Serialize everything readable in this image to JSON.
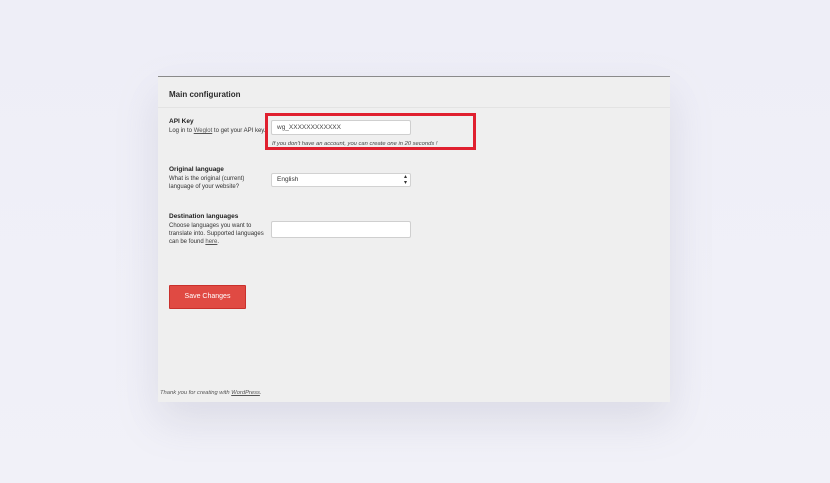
{
  "section": {
    "title": "Main configuration"
  },
  "api_key": {
    "label": "API Key",
    "desc_prefix": "Log in to ",
    "desc_link": "Weglot",
    "desc_suffix": " to get your API key.",
    "value": "wg_XXXXXXXXXXXX",
    "hint": "If you don't have an account, you can create one in 20 seconds !"
  },
  "original_language": {
    "label": "Original language",
    "desc": "What is the original (current) language of your website?",
    "selected": "English"
  },
  "destination_languages": {
    "label": "Destination languages",
    "desc_prefix": "Choose languages you want to translate into. Supported languages can be found ",
    "desc_link": "here",
    "desc_suffix": ".",
    "value": ""
  },
  "actions": {
    "save_label": "Save Changes"
  },
  "footer": {
    "prefix": "Thank you for creating with ",
    "link": "WordPress",
    "suffix": "."
  },
  "colors": {
    "highlight": "#e0202f",
    "save_button": "#e04a43",
    "panel": "#efefef"
  },
  "icons": {
    "select_arrow": "select-arrows-icon"
  }
}
